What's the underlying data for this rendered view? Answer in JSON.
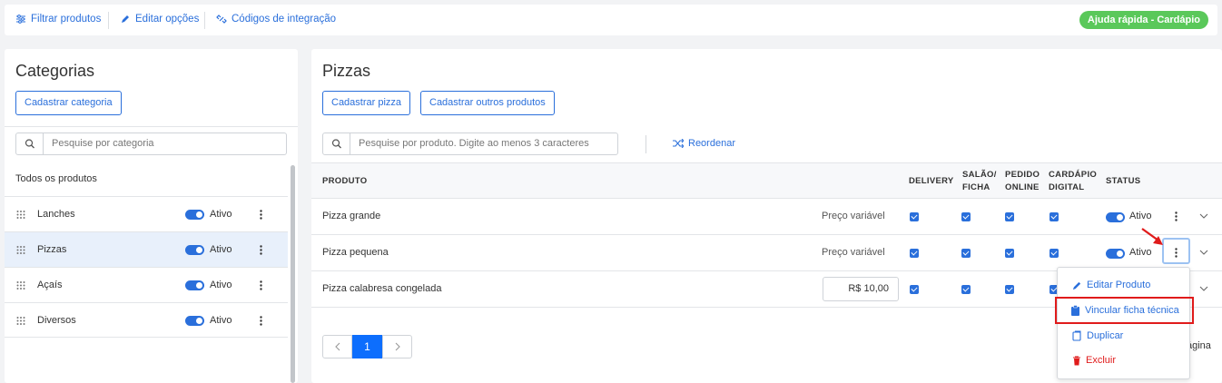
{
  "colors": {
    "accent": "#2a6fdb",
    "success": "#5ac85a",
    "danger": "#e01b1b",
    "primary_page": "#0d6efd"
  },
  "toolbar": {
    "filter_label": "Filtrar produtos",
    "edit_label": "Editar opções",
    "codes_label": "Códigos de integração",
    "help_label": "Ajuda rápida - Cardápio"
  },
  "categories": {
    "title": "Categorias",
    "add_button": "Cadastrar categoria",
    "search_placeholder": "Pesquise por categoria",
    "all_label": "Todos os produtos",
    "items": [
      {
        "name": "Lanches",
        "status": "Ativo"
      },
      {
        "name": "Pizzas",
        "status": "Ativo"
      },
      {
        "name": "Açaís",
        "status": "Ativo"
      },
      {
        "name": "Diversos",
        "status": "Ativo"
      }
    ]
  },
  "products": {
    "title": "Pizzas",
    "add_button": "Cadastrar pizza",
    "add_other_button": "Cadastrar outros produtos",
    "search_placeholder": "Pesquise por produto. Digite ao menos 3 caracteres",
    "reorder_label": "Reordenar",
    "headers": {
      "product": "PRODUTO",
      "delivery": "DELIVERY",
      "salao_1": "SALÃO/",
      "salao_2": "FICHA",
      "pedido_1": "PEDIDO",
      "pedido_2": "ONLINE",
      "cardapio_1": "CARDÁPIO",
      "cardapio_2": "DIGITAL",
      "status": "STATUS"
    },
    "rows": [
      {
        "name": "Pizza grande",
        "price": "Preço variável",
        "status": "Ativo"
      },
      {
        "name": "Pizza pequena",
        "price": "Preço variável",
        "status": "Ativo"
      },
      {
        "name": "Pizza calabresa congelada",
        "price": "R$ 10,00",
        "status": ""
      }
    ],
    "pagination": {
      "current": "1",
      "trailing_text": "ágina"
    }
  },
  "context_menu": {
    "items": [
      {
        "label": "Editar Produto",
        "icon": "pencil-icon"
      },
      {
        "label": "Vincular ficha técnica",
        "icon": "clipboard-icon"
      },
      {
        "label": "Duplicar",
        "icon": "copy-icon"
      },
      {
        "label": "Excluir",
        "icon": "trash-icon"
      }
    ]
  }
}
